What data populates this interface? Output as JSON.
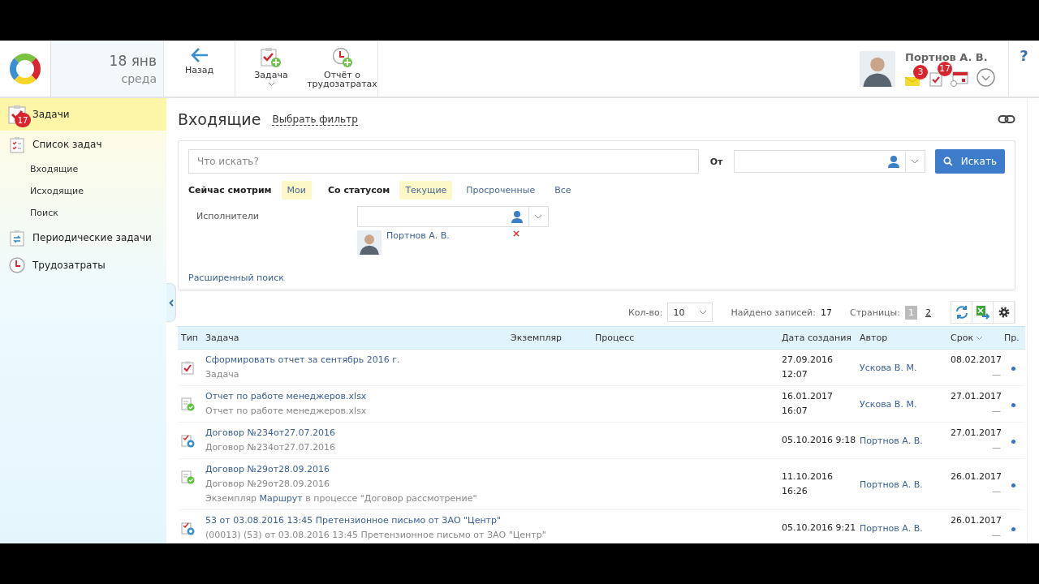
{
  "header": {
    "date": "18 янв",
    "weekday": "среда",
    "toolbar": [
      {
        "label": "Назад",
        "kind": "back",
        "dropdown": false
      },
      {
        "label": "Задача",
        "kind": "task",
        "dropdown": true
      },
      {
        "label": "Отчёт о трудозатратах",
        "kind": "report",
        "dropdown": false
      }
    ],
    "user": {
      "name": "Портнов А. В.",
      "badges": [
        {
          "kind": "mail",
          "count": "3"
        },
        {
          "kind": "tasks",
          "count": "17"
        },
        {
          "kind": "calendar"
        }
      ]
    },
    "help": "?"
  },
  "sidebar": {
    "items": [
      {
        "label": "Задачи",
        "kind": "tasks",
        "badge": "17",
        "selected": true
      },
      {
        "label": "Список задач",
        "kind": "list",
        "selected": false,
        "children": [
          {
            "label": "Входящие"
          },
          {
            "label": "Исходящие"
          },
          {
            "label": "Поиск"
          }
        ]
      },
      {
        "label": "Периодические задачи",
        "kind": "periodic",
        "selected": false
      },
      {
        "label": "Трудозатраты",
        "kind": "time",
        "selected": false
      }
    ]
  },
  "main": {
    "title": "Входящие",
    "filter_link": "Выбрать фильтр",
    "search": {
      "placeholder": "Что искать?",
      "from_label": "От",
      "button": "Искать"
    },
    "filters": [
      {
        "label": "Сейчас смотрим",
        "options": [
          {
            "label": "Мои",
            "selected": true
          }
        ]
      },
      {
        "label": "Со статусом",
        "options": [
          {
            "label": "Текущие",
            "selected": true
          },
          {
            "label": "Просроченные",
            "selected": false
          },
          {
            "label": "Все",
            "selected": false
          }
        ]
      }
    ],
    "performers": {
      "label": "Исполнители",
      "people": [
        {
          "name": "Портнов А. В."
        }
      ]
    },
    "advanced": "Расширенный поиск",
    "pager": {
      "count_label": "Кол-во:",
      "count": "10",
      "found_label": "Найдено записей:",
      "found": "17",
      "pages_label": "Страницы:",
      "pages": [
        {
          "label": "1",
          "selected": true
        },
        {
          "label": "2",
          "selected": false
        }
      ]
    },
    "table": {
      "columns": [
        {
          "label": "Тип",
          "sorted": false
        },
        {
          "label": "Задача",
          "sorted": false
        },
        {
          "label": "Экземпляр",
          "sorted": false
        },
        {
          "label": "Процесс",
          "sorted": false
        },
        {
          "label": "Дата создания",
          "sorted": false
        },
        {
          "label": "Автор",
          "sorted": false
        },
        {
          "label": "Срок",
          "sorted": true
        },
        {
          "label": "Пр.",
          "sorted": false
        }
      ],
      "rows": [
        {
          "kind": "task",
          "title": "Сформировать отчет за сентябрь 2016 г.",
          "subtitle": "Задача",
          "created": [
            "27.09.2016",
            "12:07"
          ],
          "author": "Ускова В. М.",
          "due": "08.02.2017",
          "due_sub": "—"
        },
        {
          "kind": "approve",
          "title": "Отчет по работе менеджеров.xlsx",
          "subtitle": "Отчет по работе менеджеров.xlsx",
          "created": [
            "16.01.2017",
            "16:07"
          ],
          "author": "Ускова В. М.",
          "due": "27.01.2017",
          "due_sub": "—"
        },
        {
          "kind": "review",
          "title": "Договор №234от27.07.2016",
          "subtitle": "Договор №234от27.07.2016",
          "created": [
            "05.10.2016 9:18"
          ],
          "author": "Портнов А. В.",
          "due": "27.01.2017",
          "due_sub": "—"
        },
        {
          "kind": "approve",
          "title": "Договор №29от28.09.2016",
          "subtitle": "Договор №29от28.09.2016",
          "note": {
            "before": "Экземпляр",
            "link": "Маршрут",
            "after": "в процессе \"Договор рассмотрение\""
          },
          "created": [
            "11.10.2016",
            "16:26"
          ],
          "author": "Портнов А. В.",
          "due": "26.01.2017",
          "due_sub": "—"
        },
        {
          "kind": "review",
          "title": "53 от 03.08.2016 13:45 Претензионное письмо от ЗАО \"Центр\"",
          "subtitle": "(00013) (53) от 03.08.2016 13:45 Претензионное письмо от ЗАО \"Центр\"",
          "created": [
            "05.10.2016 9:21"
          ],
          "author": "Портнов А. В.",
          "due": "26.01.2017",
          "due_sub": "—"
        }
      ]
    }
  }
}
